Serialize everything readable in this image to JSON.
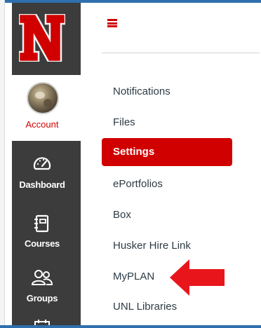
{
  "global_nav": {
    "logo": {
      "letter": "N",
      "color": "#d00000"
    },
    "account": {
      "label": "Account",
      "avatar_icon": "user-avatar"
    },
    "items": [
      {
        "label": "Dashboard",
        "icon": "dashboard-gauge-icon"
      },
      {
        "label": "Courses",
        "icon": "courses-book-icon"
      },
      {
        "label": "Groups",
        "icon": "groups-people-icon"
      }
    ]
  },
  "header": {
    "menu_icon": "hamburger-menu-icon",
    "accent_color": "#d00000"
  },
  "course_nav": {
    "items": [
      {
        "label": "Notifications",
        "active": false
      },
      {
        "label": "Files",
        "active": false
      },
      {
        "label": "Settings",
        "active": true
      },
      {
        "label": "ePortfolios",
        "active": false
      },
      {
        "label": "Box",
        "active": false
      },
      {
        "label": "Husker Hire Link",
        "active": false
      },
      {
        "label": "MyPLAN",
        "active": false
      },
      {
        "label": "UNL Libraries",
        "active": false
      }
    ]
  },
  "annotation": {
    "icon": "red-arrow-icon",
    "color": "#e8161b",
    "points_to": "MyPLAN"
  }
}
